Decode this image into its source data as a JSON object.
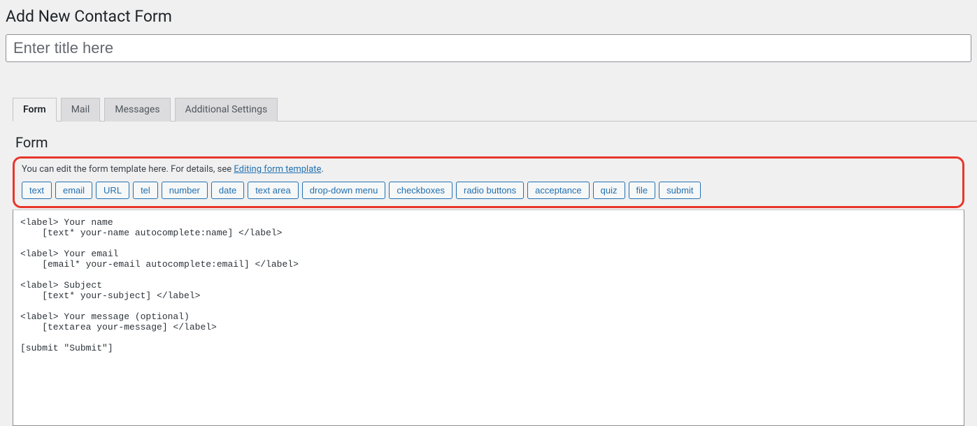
{
  "page": {
    "title": "Add New Contact Form"
  },
  "title_input": {
    "placeholder": "Enter title here",
    "value": ""
  },
  "tabs": [
    {
      "label": "Form",
      "active": true
    },
    {
      "label": "Mail",
      "active": false
    },
    {
      "label": "Messages",
      "active": false
    },
    {
      "label": "Additional Settings",
      "active": false
    }
  ],
  "panel": {
    "heading": "Form",
    "hint_prefix": "You can edit the form template here. For details, see ",
    "hint_link": "Editing form template",
    "hint_suffix": "."
  },
  "tag_buttons": [
    "text",
    "email",
    "URL",
    "tel",
    "number",
    "date",
    "text area",
    "drop-down menu",
    "checkboxes",
    "radio buttons",
    "acceptance",
    "quiz",
    "file",
    "submit"
  ],
  "form_template": "<label> Your name\n    [text* your-name autocomplete:name] </label>\n\n<label> Your email\n    [email* your-email autocomplete:email] </label>\n\n<label> Subject\n    [text* your-subject] </label>\n\n<label> Your message (optional)\n    [textarea your-message] </label>\n\n[submit \"Submit\"]"
}
